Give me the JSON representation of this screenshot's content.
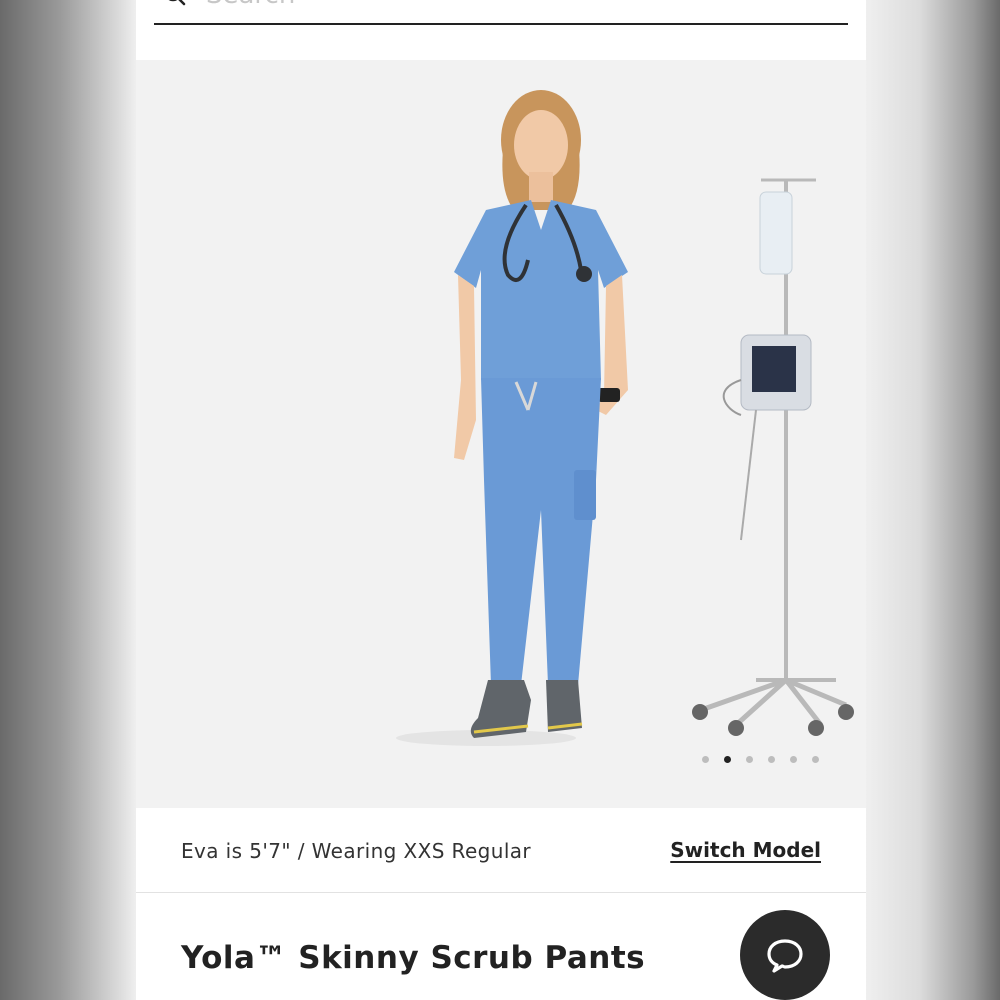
{
  "search": {
    "placeholder": "Search"
  },
  "gallery": {
    "image_description_icon": "product-photo",
    "dots_count": 6,
    "active_index": 1
  },
  "model_info": {
    "text": "Eva is 5'7\" / Wearing XXS Regular",
    "switch_label": "Switch Model"
  },
  "product": {
    "title": "Yola™ Skinny Scrub Pants"
  },
  "chat": {
    "icon": "chat-bubble-icon"
  },
  "colors": {
    "scrub_blue": "#6f9fd8",
    "dark": "#222222",
    "chat_bg": "#2b2b2b"
  }
}
